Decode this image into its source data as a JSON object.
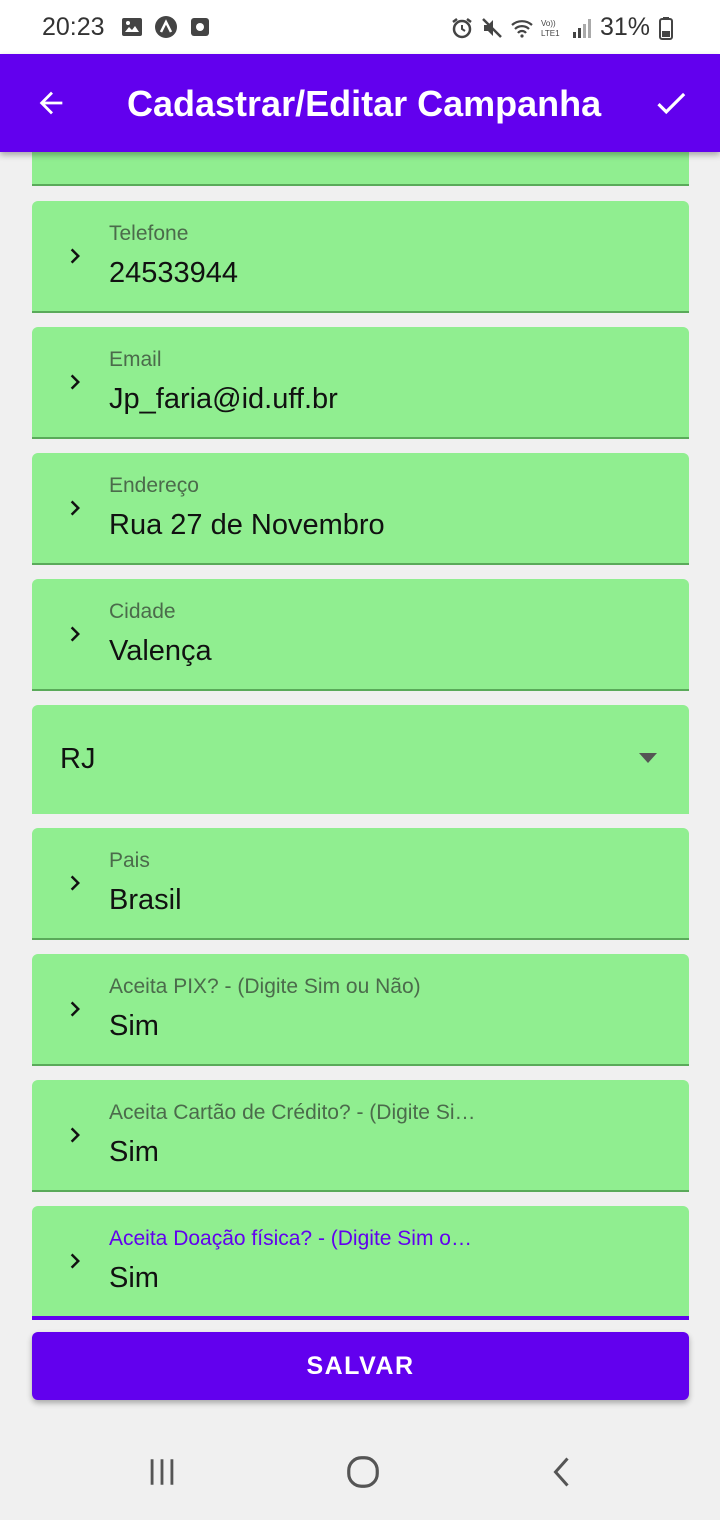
{
  "status_bar": {
    "time": "20:23",
    "battery": "31%",
    "icons": [
      "image-icon",
      "app-icon",
      "record-icon",
      "alarm-icon",
      "mute-icon",
      "wifi-icon",
      "lte-icon",
      "signal-icon",
      "battery-icon"
    ]
  },
  "app_bar": {
    "title": "Cadastrar/Editar Campanha",
    "back_icon": "arrow-back-icon",
    "confirm_icon": "check-icon"
  },
  "fields": [
    {
      "label": "Telefone",
      "value": "24533944"
    },
    {
      "label": "Email",
      "value": "Jp_faria@id.uff.br"
    },
    {
      "label": "Endereço",
      "value": "Rua 27 de Novembro"
    },
    {
      "label": "Cidade",
      "value": "Valença"
    },
    {
      "label": "Pais",
      "value": "Brasil"
    },
    {
      "label": "Aceita PIX? - (Digite Sim ou Não)",
      "value": "Sim"
    },
    {
      "label": "Aceita Cartão de Crédito? - (Digite Si…",
      "value": "Sim"
    },
    {
      "label": "Aceita Doação física? - (Digite Sim o…",
      "value": "Sim"
    }
  ],
  "state_select": {
    "value": "RJ"
  },
  "save_button": {
    "label": "SALVAR"
  },
  "colors": {
    "primary": "#6200ee",
    "field_bg": "#90ee90"
  }
}
